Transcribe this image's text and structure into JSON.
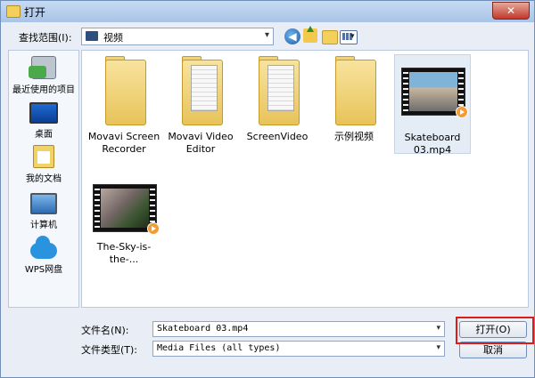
{
  "window": {
    "title": "打开",
    "close_symbol": "✕"
  },
  "look_in": {
    "label": "查找范围(I):",
    "value": "视频",
    "arrow": "▾"
  },
  "toolbar": {
    "back_symbol": "◀",
    "view_arrow": "▾"
  },
  "sidebar": {
    "items": [
      {
        "label": "最近使用的项目",
        "icon": "recent-items-icon"
      },
      {
        "label": "桌面",
        "icon": "desktop-icon"
      },
      {
        "label": "我的文档",
        "icon": "documents-icon"
      },
      {
        "label": "计算机",
        "icon": "computer-icon"
      },
      {
        "label": "WPS网盘",
        "icon": "cloud-drive-icon"
      }
    ]
  },
  "files": [
    {
      "name": "Movavi Screen Recorder",
      "type": "folder"
    },
    {
      "name": "Movavi Video Editor",
      "type": "folder"
    },
    {
      "name": "ScreenVideo",
      "type": "folder"
    },
    {
      "name": "示例视频",
      "type": "folder"
    },
    {
      "name": "Skateboard 03.mp4",
      "type": "video",
      "selected": true
    },
    {
      "name": "The-Sky-is-the-...",
      "type": "video"
    }
  ],
  "filename": {
    "label": "文件名(N):",
    "value": "Skateboard 03.mp4",
    "arrow": "▾"
  },
  "filetype": {
    "label": "文件类型(T):",
    "value": "Media Files (all types)",
    "arrow": "▾"
  },
  "buttons": {
    "open": "打开(O)",
    "cancel": "取消"
  },
  "colors": {
    "highlight": "#e01919",
    "selection": "#e4ecf6"
  }
}
